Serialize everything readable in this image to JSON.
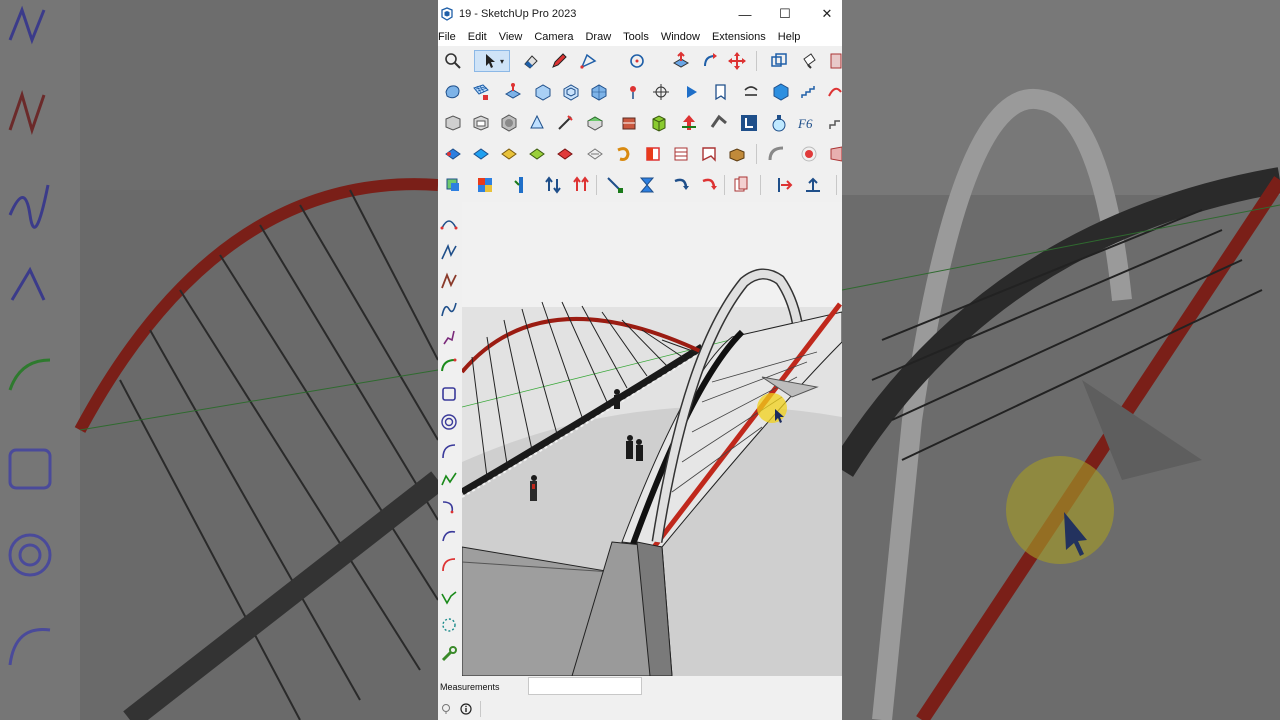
{
  "window": {
    "title": "19 - SketchUp Pro 2023"
  },
  "window_controls": {
    "minimize": "—",
    "maximize": "☐",
    "close": "✕"
  },
  "menu": {
    "items": [
      "File",
      "Edit",
      "View",
      "Camera",
      "Draw",
      "Tools",
      "Window",
      "Extensions",
      "Help"
    ]
  },
  "status": {
    "measurements_label": "Measurements",
    "measurements_value": ""
  },
  "colors": {
    "accent_red": "#c0281c",
    "selection_blue": "#cfe3f7",
    "cursor_highlight": "#f2d21a"
  },
  "toolbars": {
    "row1": [
      "zoom-icon",
      "select-icon",
      "eraser-icon",
      "pencil-icon",
      "line-dropdown-icon",
      "circle-dropdown-icon",
      "push-pull-icon",
      "follow-me-icon",
      "move-icon",
      "scale-icon",
      "paint-icon",
      "outliner-icon"
    ],
    "row2": [
      "solid-tools-icon",
      "grid-icon",
      "extrude-icon",
      "shell-icon",
      "offset-icon",
      "surface-icon",
      "pin-icon",
      "section-icon",
      "play-icon",
      "component-icon",
      "tag-icon",
      "sphere-icon",
      "stair-icon",
      "curve-icon"
    ],
    "row3": [
      "box-icon",
      "box2-icon",
      "sphere-solid-icon",
      "cone-icon",
      "edit-icon",
      "cube-green-icon",
      "texture-icon",
      "green-box-icon",
      "red-arrow-icon",
      "bend-icon",
      "blue-tool-icon",
      "flask-icon",
      "font-icon",
      "stair2-icon"
    ],
    "row4": [
      "diamond-blue-icon",
      "diamond-blue2-icon",
      "diamond-yellow-icon",
      "diamond-green-icon",
      "diamond-red-icon",
      "diamond-outline-icon",
      "curl-icon",
      "red-square-icon",
      "rows-icon",
      "flag-icon",
      "brick-icon",
      "arc-icon",
      "red-dot-icon",
      "shape-icon"
    ],
    "row5": [
      "layer-tool-icon",
      "color-cube-icon",
      "blue-bars-icon",
      "arrows-updown-icon",
      "arrows-red-icon",
      "diagonal-icon",
      "hourglass-icon",
      "rotate-blue-icon",
      "rotate-red-icon",
      "copy-red-icon",
      "arrow-right-red-icon",
      "arrow-up-blue-icon"
    ]
  },
  "left_tools": [
    "arc-tool-icon",
    "bezier-tool-icon",
    "freehand-tool-icon",
    "polyline-tool-icon",
    "spline-tool-icon",
    "green-arc-icon",
    "rect-tool-icon",
    "spiral-tool-icon",
    "arc2-tool-icon",
    "green-zigzag-icon",
    "curve-tool-icon",
    "curve2-tool-icon",
    "red-arc-icon",
    "green-check-icon",
    "circle-dots-icon",
    "wrench-icon"
  ]
}
